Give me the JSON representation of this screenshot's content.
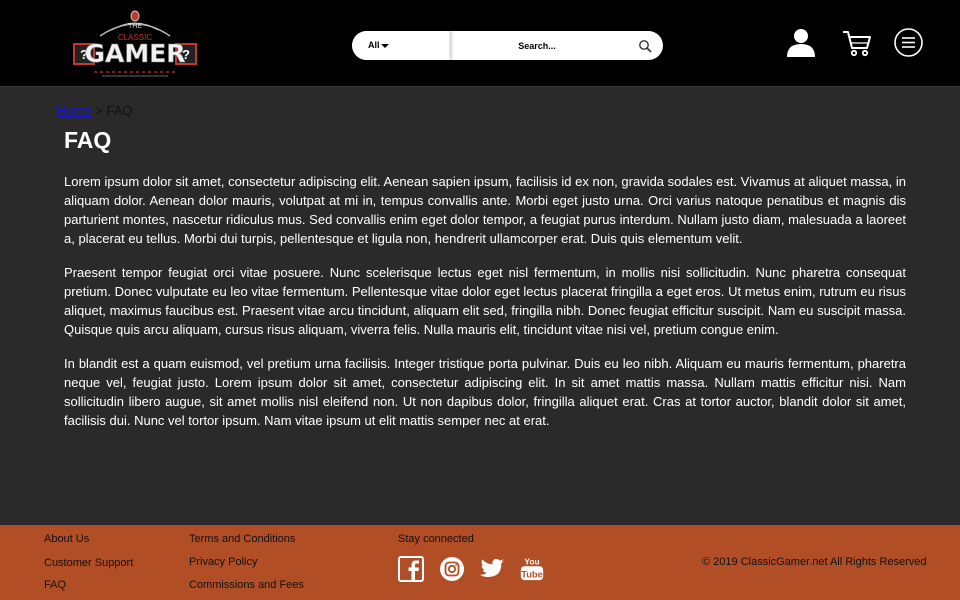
{
  "header": {
    "logo": {
      "top_text": "THE",
      "mid_text": "CLASSIC",
      "main_text": "GAMER"
    },
    "search": {
      "category": "All",
      "placeholder": "Search..."
    }
  },
  "breadcrumb": {
    "home": "Home",
    "separator": " > ",
    "current": "FAQ"
  },
  "page": {
    "title": "FAQ",
    "paragraphs": [
      "Lorem ipsum dolor sit amet, consectetur adipiscing elit. Aenean sapien ipsum, facilisis id ex non, gravida sodales est. Vivamus at aliquet massa, in aliquam dolor. Aenean dolor mauris, volutpat at mi in, tempus convallis ante. Morbi eget justo urna. Orci varius natoque penatibus et magnis dis parturient montes, nascetur ridiculus mus. Sed convallis enim eget dolor tempor, a feugiat purus interdum. Nullam justo diam, malesuada a laoreet a, placerat eu tellus. Morbi dui turpis, pellentesque et ligula non, hendrerit ullamcorper erat. Duis quis elementum velit.",
      "Praesent tempor feugiat orci vitae posuere. Nunc scelerisque lectus eget nisl fermentum, in mollis nisi sollicitudin. Nunc pharetra consequat pretium. Donec vulputate eu leo vitae fermentum. Pellentesque vitae dolor eget lectus placerat fringilla a eget eros. Ut metus enim, rutrum eu risus aliquet, maximus faucibus est. Praesent vitae arcu tincidunt, aliquam elit sed, fringilla nibh. Donec feugiat efficitur suscipit. Nam eu suscipit massa. Quisque quis arcu aliquam, cursus risus aliquam, viverra felis. Nulla mauris elit, tincidunt vitae nisi vel, pretium congue enim.",
      "In blandit est a quam euismod, vel pretium urna facilisis. Integer tristique porta pulvinar. Duis eu leo nibh. Aliquam eu mauris fermentum, pharetra neque vel, feugiat justo. Lorem ipsum dolor sit amet, consectetur adipiscing elit. In sit amet mattis massa. Nullam mattis efficitur nisi. Nam sollicitudin libero augue, sit amet mollis nisl eleifend non. Ut non dapibus dolor, fringilla aliquet erat. Cras at tortor auctor, blandit dolor sit amet, facilisis dui. Nunc vel tortor ipsum. Nam vitae ipsum ut elit mattis semper nec at erat."
    ]
  },
  "footer": {
    "col1": [
      "About Us",
      "Customer Support",
      "FAQ"
    ],
    "col2": [
      "Terms and Conditions",
      "Privacy Policy",
      "Commissions and Fees"
    ],
    "stay_connected": "Stay connected",
    "social": [
      "facebook-icon",
      "instagram-icon",
      "twitter-icon",
      "youtube-icon"
    ],
    "youtube_label": "You Tube",
    "copyright": "© 2019 ClassicGamer.net All Rights Reserved"
  },
  "colors": {
    "header_bg": "#000000",
    "main_bg": "#2a2a2a",
    "footer_bg": "#b24e25",
    "logo_accent": "#c0392b",
    "link": "#1414d2"
  }
}
